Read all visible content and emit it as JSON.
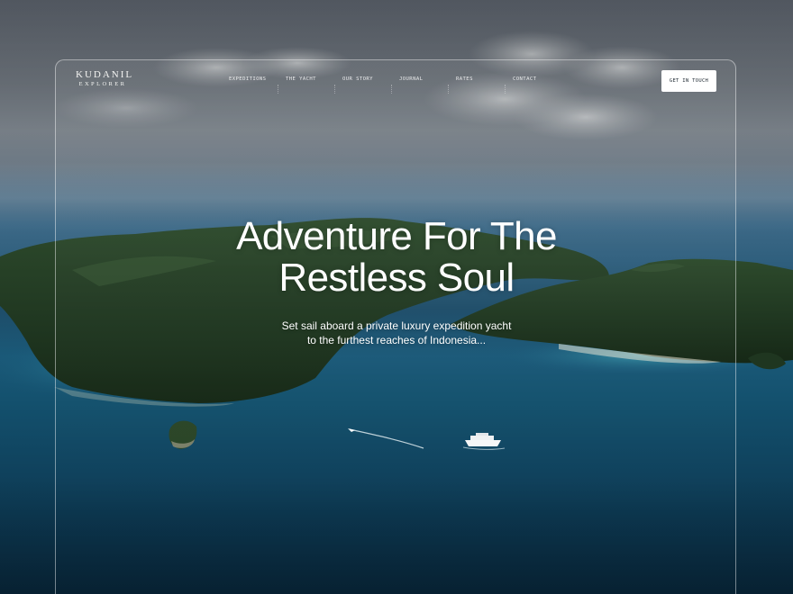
{
  "brand": {
    "name_top": "KUDANIL",
    "name_bottom": "EXPLORER"
  },
  "nav": {
    "items": [
      {
        "label": "EXPEDITIONS"
      },
      {
        "label": "THE YACHT"
      },
      {
        "label": "OUR STORY"
      },
      {
        "label": "JOURNAL"
      },
      {
        "label": "RATES"
      },
      {
        "label": "CONTACT"
      }
    ]
  },
  "cta": {
    "label": "GET IN TOUCH"
  },
  "hero": {
    "title_line1": "Adventure For The",
    "title_line2": "Restless Soul",
    "subtitle_line1": "Set sail aboard a private luxury expedition yacht",
    "subtitle_line2": "to the furthest reaches of Indonesia..."
  },
  "colors": {
    "frame_border": "#ffffff",
    "cta_background": "#ffffff",
    "cta_text": "#1f2a33",
    "ocean_deep": "#0a2f47",
    "ocean_shallow": "#1a5978",
    "forest": "#233a24"
  }
}
